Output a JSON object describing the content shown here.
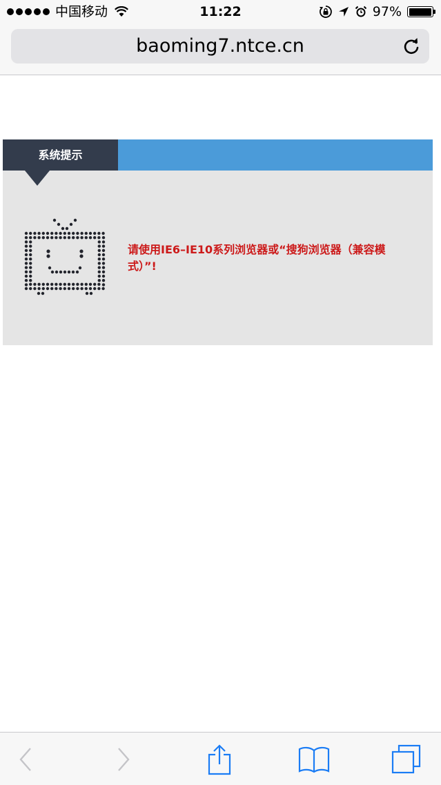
{
  "status_bar": {
    "carrier": "中国移动",
    "time": "11:22",
    "battery_percent": "97%",
    "battery_level": 0.97
  },
  "browser": {
    "url": "baoming7.ntce.cn"
  },
  "notice": {
    "tab_title": "系统提示",
    "message": "请使用IE6–IE10系列浏览器或“搜狗浏览器（兼容模式）”!"
  },
  "colors": {
    "header_blue": "#4b9bd9",
    "tab_dark": "#333c4c",
    "panel_gray": "#e5e5e5",
    "message_red": "#cc1a1a",
    "ios_blue": "#1a7cf5"
  },
  "icons": {
    "status": [
      "signal-dots-icon",
      "wifi-icon",
      "orientation-lock-icon",
      "location-arrow-icon",
      "alarm-clock-icon",
      "battery-icon"
    ],
    "toolbar": [
      "back-arrow-icon",
      "forward-arrow-icon",
      "share-icon",
      "bookmarks-icon",
      "tabs-icon"
    ],
    "content": [
      "dotted-tv-icon",
      "reload-icon"
    ]
  }
}
